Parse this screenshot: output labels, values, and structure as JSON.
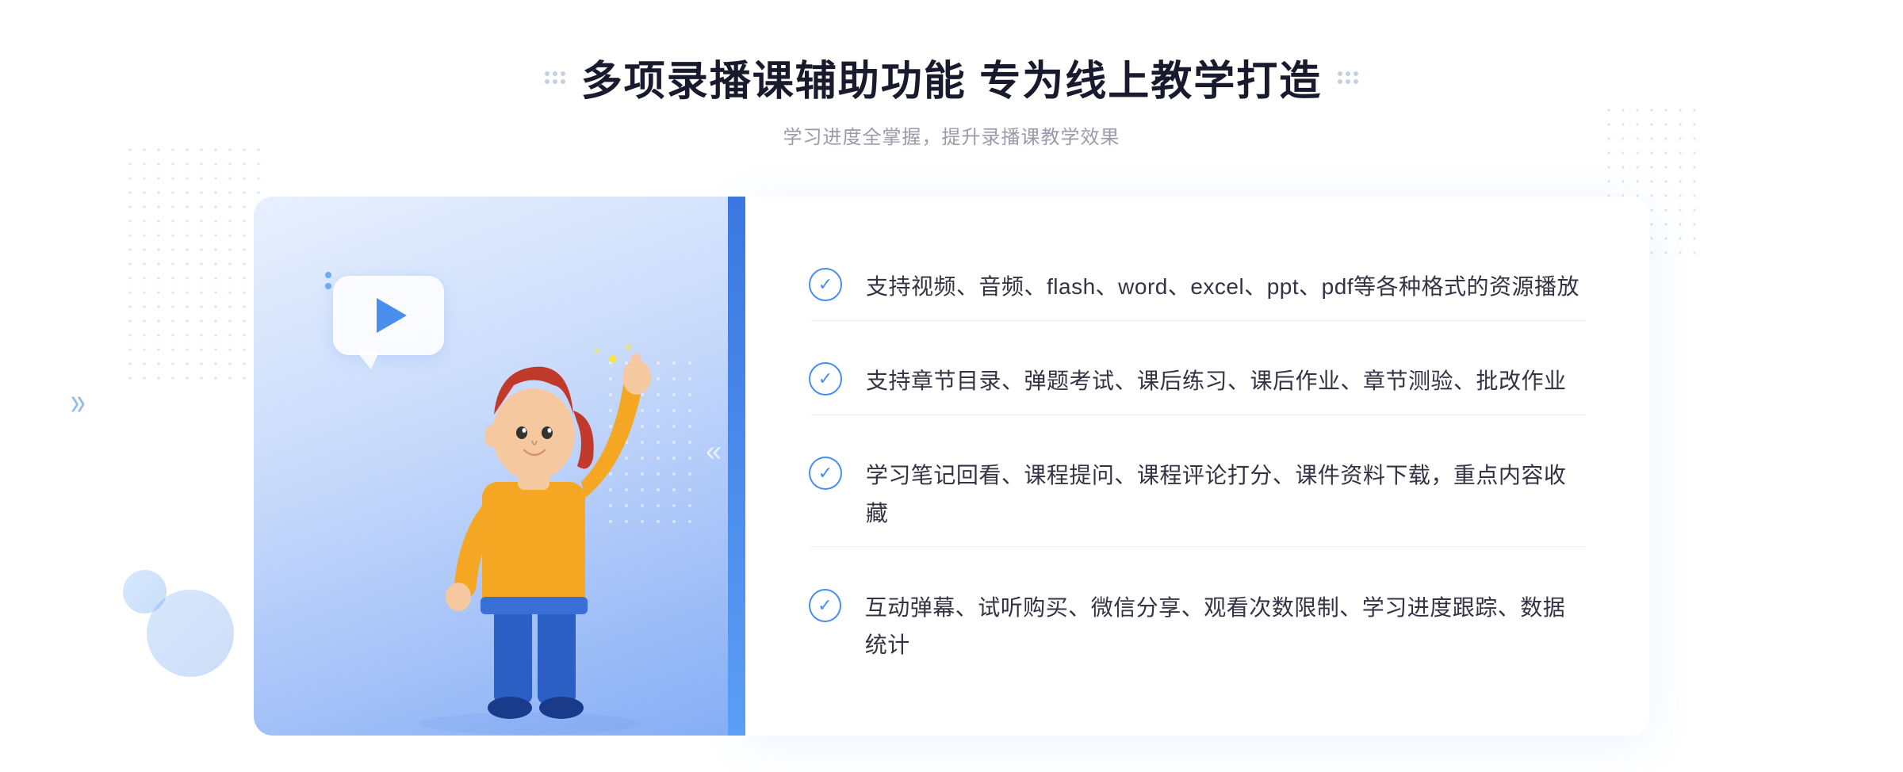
{
  "header": {
    "title": "多项录播课辅助功能 专为线上教学打造",
    "subtitle": "学习进度全掌握，提升录播课教学效果",
    "decorator_left": "decorative-dots-left",
    "decorator_right": "decorative-dots-right"
  },
  "features": [
    {
      "id": 1,
      "text": "支持视频、音频、flash、word、excel、ppt、pdf等各种格式的资源播放"
    },
    {
      "id": 2,
      "text": "支持章节目录、弹题考试、课后练习、课后作业、章节测验、批改作业"
    },
    {
      "id": 3,
      "text": "学习笔记回看、课程提问、课程评论打分、课件资料下载，重点内容收藏"
    },
    {
      "id": 4,
      "text": "互动弹幕、试听购买、微信分享、观看次数限制、学习进度跟踪、数据统计"
    }
  ],
  "colors": {
    "primary_blue": "#4a8eed",
    "title_color": "#1a1a2e",
    "subtitle_color": "#999aab",
    "text_color": "#333344",
    "bg_gradient_start": "#e8f0fd",
    "bg_gradient_end": "#85adf5"
  }
}
